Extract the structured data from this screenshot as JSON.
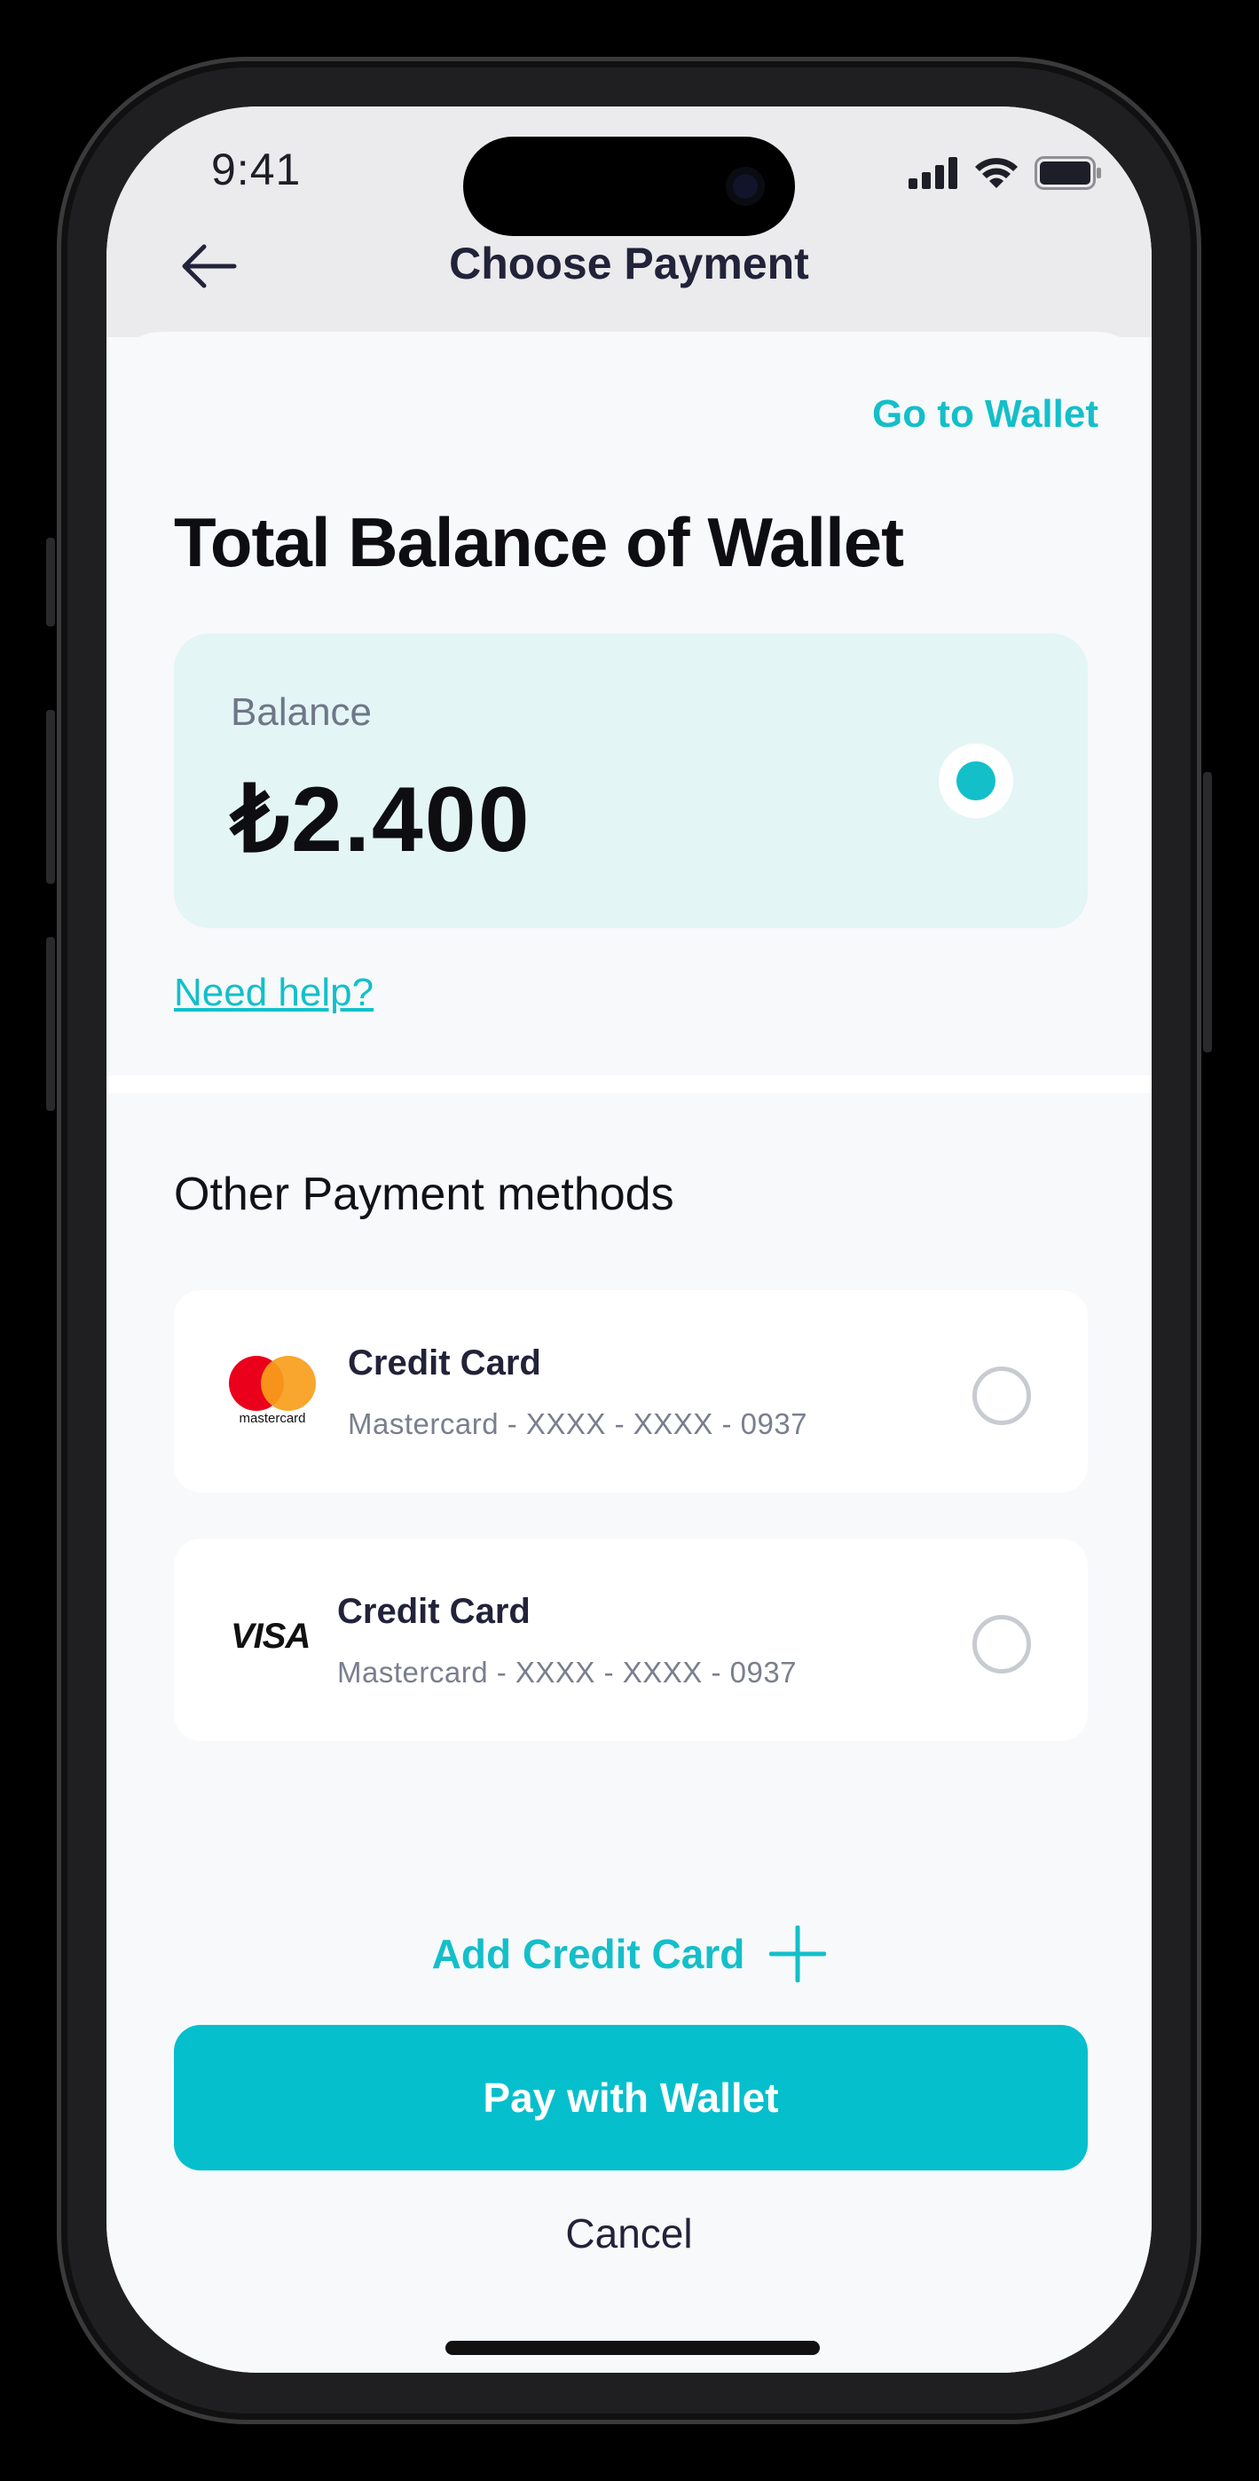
{
  "status_bar": {
    "time": "9:41"
  },
  "header": {
    "title": "Choose Payment",
    "back_icon": "arrow-left-icon"
  },
  "wallet": {
    "go_to_wallet": "Go to Wallet",
    "section_title": "Total Balance of Wallet",
    "balance_label": "Balance",
    "balance_amount": "₺2.400",
    "selected": true,
    "help_link": "Need help?"
  },
  "other_methods": {
    "title": "Other Payment methods",
    "cards": [
      {
        "brand": "mastercard",
        "brand_label": "mastercard",
        "title": "Credit Card",
        "subtitle": "Mastercard - XXXX - XXXX  - 0937",
        "selected": false
      },
      {
        "brand": "visa",
        "brand_label": "VISA",
        "title": "Credit Card",
        "subtitle": "Mastercard - XXXX - XXXX  - 0937",
        "selected": false
      }
    ],
    "add_card_label": "Add Credit Card",
    "add_icon": "plus-icon"
  },
  "actions": {
    "pay_label": "Pay with Wallet",
    "cancel_label": "Cancel"
  },
  "colors": {
    "accent": "#13bfc9",
    "button": "#05bfcd",
    "card_bg": "#e3f5f5",
    "mc_red": "#eb001b",
    "mc_orange": "#f79e1b"
  }
}
